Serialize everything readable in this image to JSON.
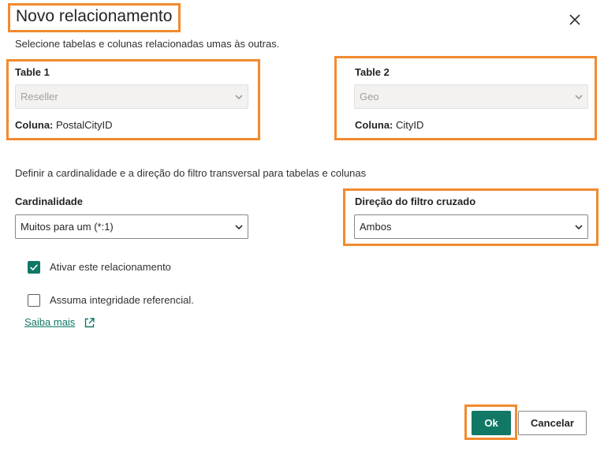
{
  "dialog": {
    "title": "Novo relacionamento",
    "subtitle": "Selecione tabelas e colunas relacionadas umas às outras."
  },
  "table1": {
    "label": "Table 1",
    "selected": "Reseller",
    "coluna_label": "Coluna:",
    "coluna_value": "PostalCityID"
  },
  "table2": {
    "label": "Table 2",
    "selected": "Geo",
    "coluna_label": "Coluna:",
    "coluna_value": "CityID"
  },
  "section": {
    "description": "Definir a cardinalidade e a direção do filtro transversal para tabelas e colunas"
  },
  "cardinality": {
    "label": "Cardinalidade",
    "selected": "Muitos para um (*:1)"
  },
  "crossfilter": {
    "label": "Direção do filtro cruzado",
    "selected": "Ambos"
  },
  "options": {
    "activate_label": "Ativar este relacionamento",
    "activate_checked": true,
    "integrity_label": "Assuma integridade referencial.",
    "integrity_checked": false
  },
  "learn_more": "Saiba mais",
  "buttons": {
    "ok": "Ok",
    "cancel": "Cancelar"
  },
  "colors": {
    "accent": "#117865",
    "highlight": "#f28a2e"
  },
  "icons": [
    "close-icon",
    "chevron-down-icon",
    "checkmark-icon",
    "external-link-icon"
  ]
}
